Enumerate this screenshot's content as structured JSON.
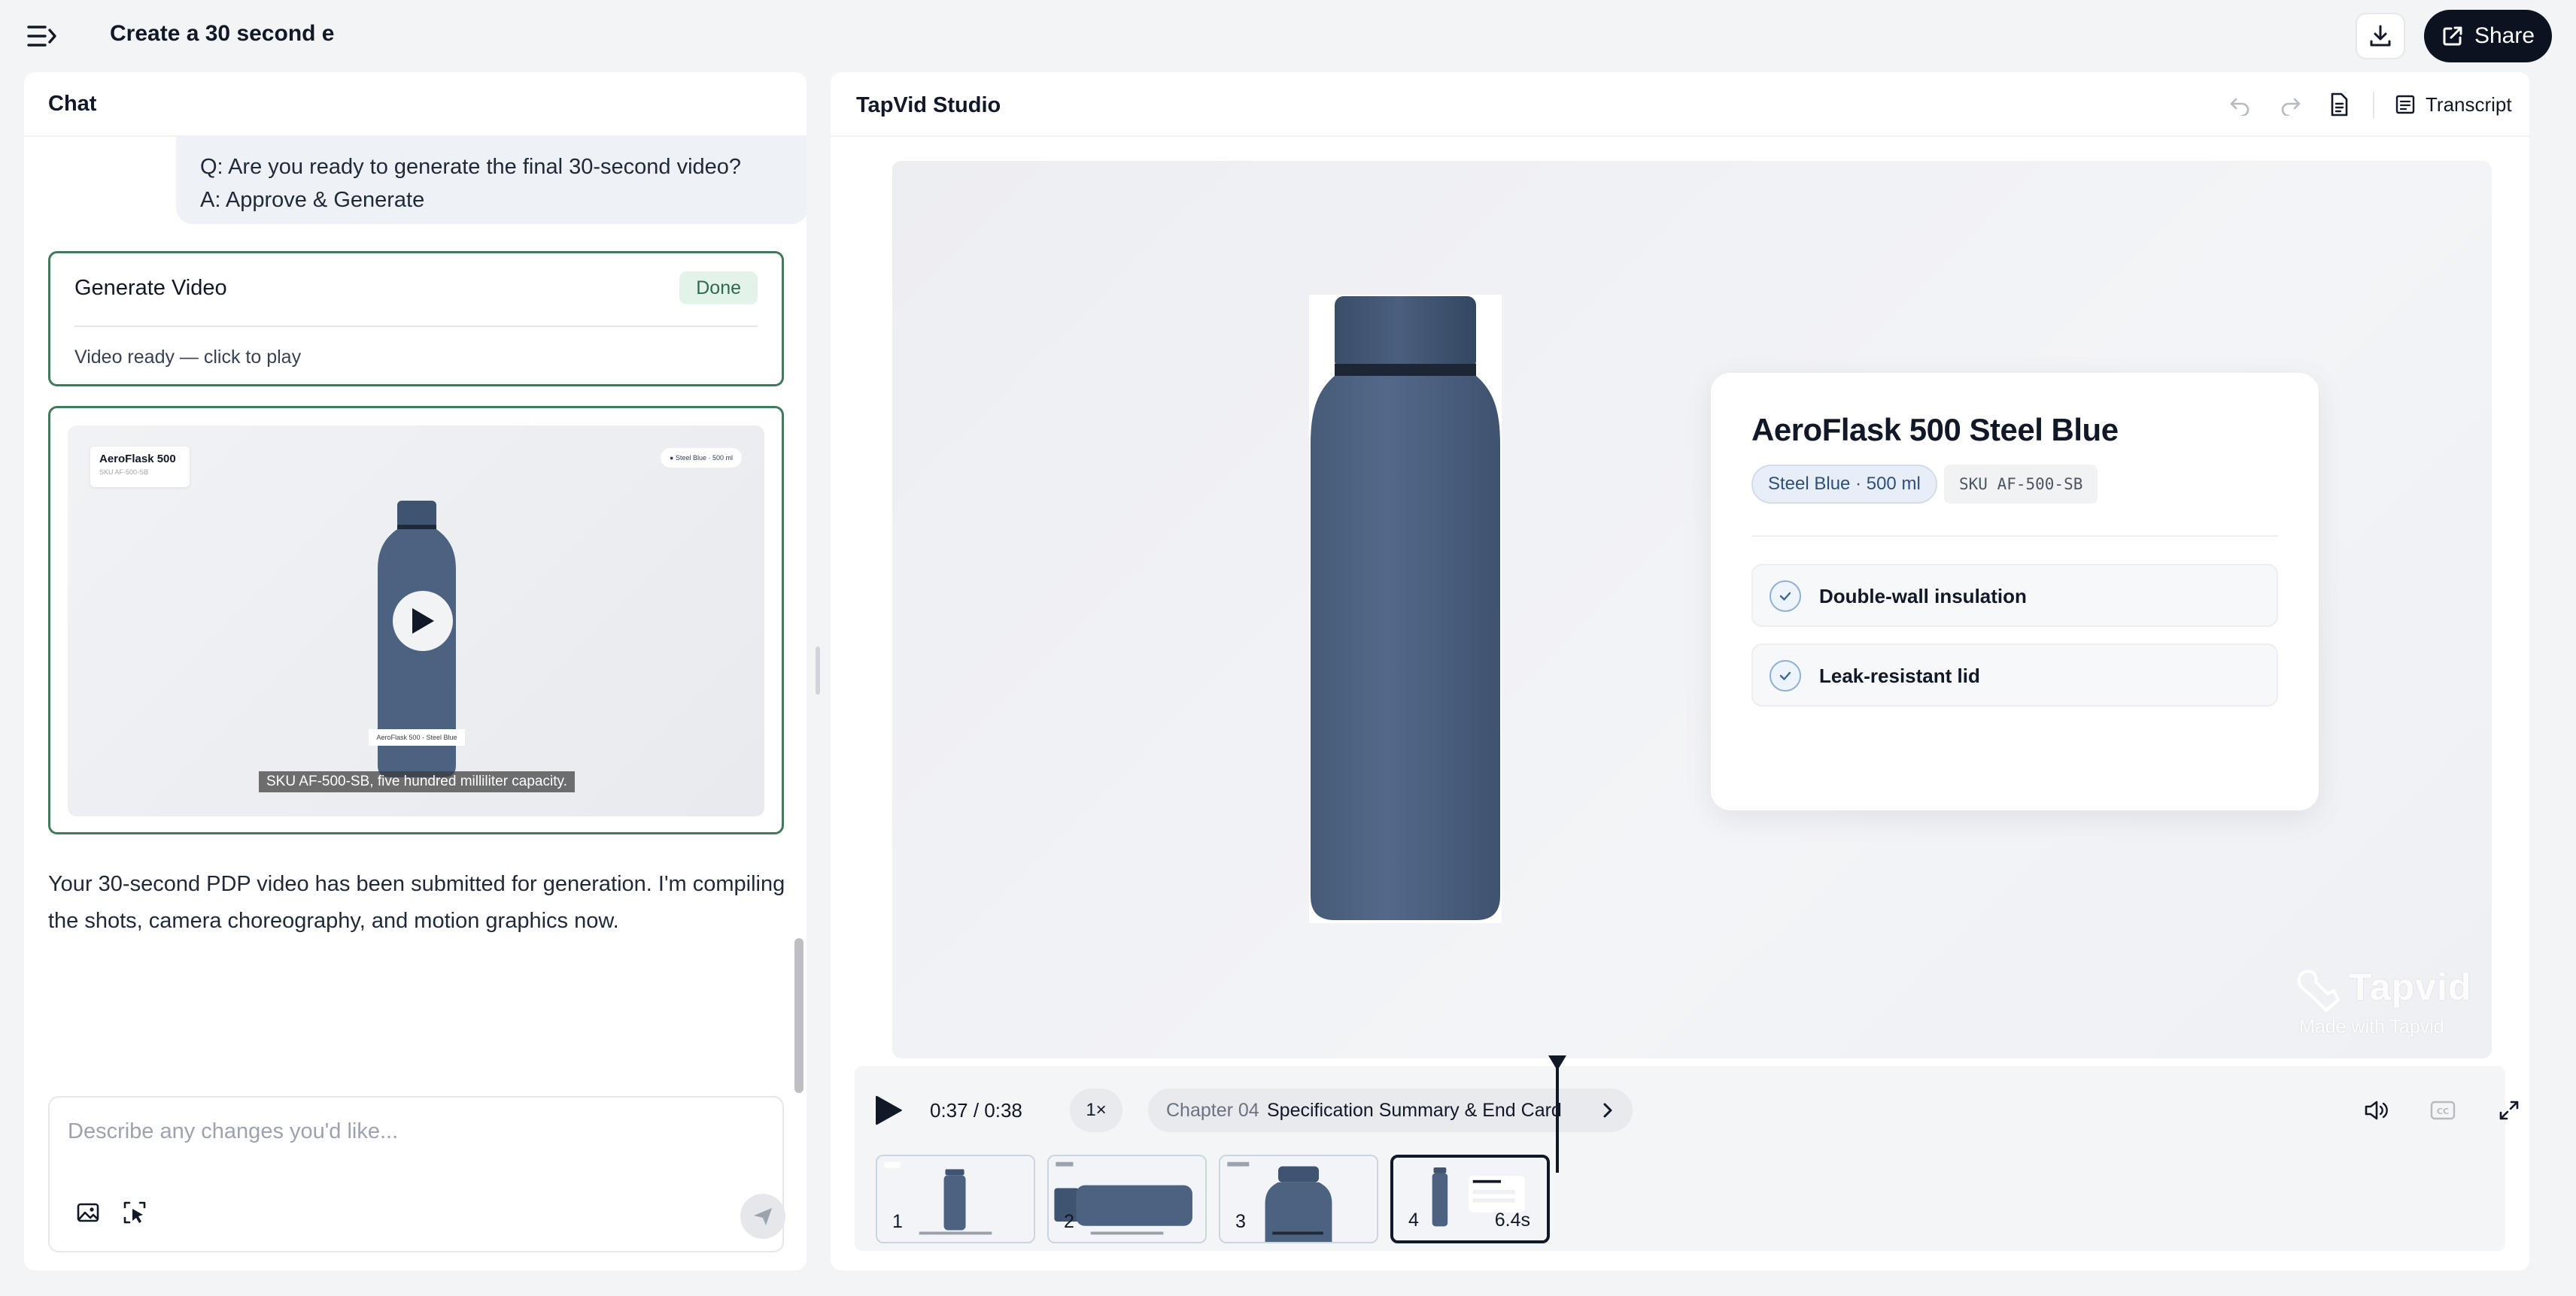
{
  "header": {
    "title": "Create a 30 second e",
    "share_label": "Share"
  },
  "chat": {
    "title": "Chat",
    "user_message": {
      "question": "Q: Are you ready to generate the final 30-second video?",
      "answer": "A: Approve & Generate"
    },
    "generate_card": {
      "title": "Generate Video",
      "badge": "Done",
      "status": "Video ready — click to play"
    },
    "video_card": {
      "label_title": "AeroFlask 500",
      "label_sku": "SKU AF-500-SB",
      "chip": "● Steel Blue · 500 ml",
      "bottle_label": "AeroFlask 500 · Steel Blue",
      "caption": "SKU AF-500-SB, five hundred milliliter capacity."
    },
    "assistant_message": "Your 30-second PDP video has been submitted for generation. I'm compiling the shots, camera choreography, and motion graphics now.",
    "composer": {
      "placeholder": "Describe any changes you'd like..."
    }
  },
  "studio": {
    "title": "TapVid Studio",
    "transcript_label": "Transcript",
    "spec_card": {
      "title": "AeroFlask 500 Steel Blue",
      "color_chip": "Steel Blue · 500 ml",
      "sku_chip": "SKU AF-500-SB",
      "features": [
        "Double-wall insulation",
        "Leak-resistant lid"
      ]
    },
    "watermark": {
      "logo": "Tapvid",
      "sub": "Made with Tapvid"
    },
    "controls": {
      "time": "0:37 / 0:38",
      "speed": "1×",
      "chapter_num": "Chapter 04",
      "chapter_name": "Specification Summary & End Card"
    },
    "clips": [
      {
        "num": "1",
        "duration": ""
      },
      {
        "num": "2",
        "duration": ""
      },
      {
        "num": "3",
        "duration": ""
      },
      {
        "num": "4",
        "duration": "6.4s"
      }
    ]
  },
  "colors": {
    "accent_dark": "#0b1220",
    "success_border": "#3f7a5a",
    "bottle_blue": "#4b6280"
  },
  "icons": {
    "menu": "sidebar-toggle-icon",
    "download": "download-icon",
    "share": "external-link-icon",
    "undo": "undo-icon",
    "redo": "redo-icon",
    "document": "document-icon",
    "transcript": "transcript-icon",
    "image_upload": "image-icon",
    "cursor_select": "cursor-select-icon",
    "send": "send-icon",
    "play": "play-icon",
    "volume": "volume-icon",
    "captions": "cc-icon",
    "fullscreen": "fullscreen-icon"
  }
}
